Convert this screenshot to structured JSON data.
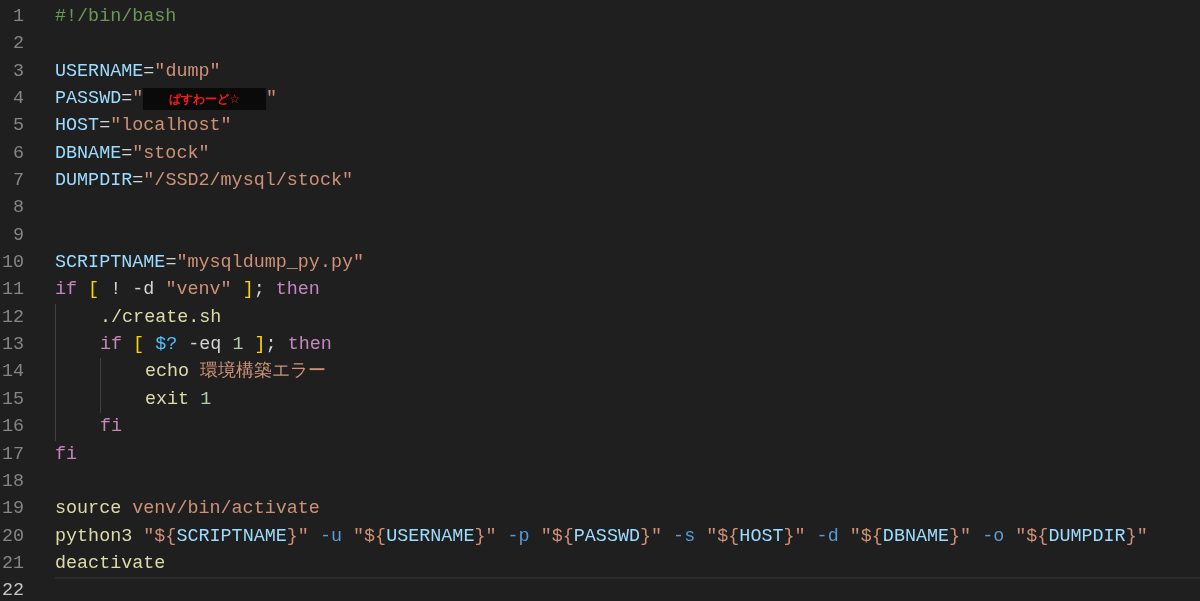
{
  "editor": {
    "lines": [
      {
        "number": "1",
        "current": false,
        "tokens": [
          {
            "text": "#!/bin/bash",
            "kind": "comment"
          }
        ]
      },
      {
        "number": "2",
        "current": false
      },
      {
        "number": "3",
        "current": false,
        "tokens": [
          {
            "text": "USERNAME",
            "kind": "var"
          },
          {
            "text": "=",
            "kind": "op"
          },
          {
            "text": "\"dump\"",
            "kind": "string"
          }
        ]
      },
      {
        "number": "4",
        "current": false,
        "tokens": [
          {
            "text": "PASSWD",
            "kind": "var"
          },
          {
            "text": "=",
            "kind": "op"
          },
          {
            "text": "\"",
            "kind": "string"
          },
          {
            "text": "ぱすわーど☆",
            "kind": "redaction"
          },
          {
            "text": "\"",
            "kind": "string"
          }
        ]
      },
      {
        "number": "5",
        "current": false,
        "tokens": [
          {
            "text": "HOST",
            "kind": "var"
          },
          {
            "text": "=",
            "kind": "op"
          },
          {
            "text": "\"localhost\"",
            "kind": "string"
          }
        ]
      },
      {
        "number": "6",
        "current": false,
        "tokens": [
          {
            "text": "DBNAME",
            "kind": "var"
          },
          {
            "text": "=",
            "kind": "op"
          },
          {
            "text": "\"stock\"",
            "kind": "string"
          }
        ]
      },
      {
        "number": "7",
        "current": false,
        "tokens": [
          {
            "text": "DUMPDIR",
            "kind": "var"
          },
          {
            "text": "=",
            "kind": "op"
          },
          {
            "text": "\"/SSD2/mysql/stock\"",
            "kind": "string"
          }
        ]
      },
      {
        "number": "8",
        "current": false
      },
      {
        "number": "9",
        "current": false
      },
      {
        "number": "10",
        "current": false,
        "tokens": [
          {
            "text": "SCRIPTNAME",
            "kind": "var"
          },
          {
            "text": "=",
            "kind": "op"
          },
          {
            "text": "\"mysqldump_py.py\"",
            "kind": "string"
          }
        ]
      },
      {
        "number": "11",
        "current": false,
        "tokens": [
          {
            "text": "if",
            "kind": "keyword"
          },
          {
            "text": " [",
            "kind": "bracket"
          },
          {
            "text": " ! -d ",
            "kind": "op"
          },
          {
            "text": "\"venv\"",
            "kind": "string"
          },
          {
            "text": " ]",
            "kind": "bracket"
          },
          {
            "text": "; ",
            "kind": "op"
          },
          {
            "text": "then",
            "kind": "keyword"
          }
        ],
        "children": [
          {
            "number": "12",
            "current": false,
            "tokens": [
              {
                "text": "./create.sh",
                "kind": "command"
              }
            ]
          },
          {
            "number": "13",
            "current": false,
            "tokens": [
              {
                "text": "if",
                "kind": "keyword"
              },
              {
                "text": " [",
                "kind": "bracket"
              },
              {
                "text": " $?",
                "kind": "special"
              },
              {
                "text": " -eq ",
                "kind": "op"
              },
              {
                "text": "1",
                "kind": "number"
              },
              {
                "text": " ]",
                "kind": "bracket"
              },
              {
                "text": "; ",
                "kind": "op"
              },
              {
                "text": "then",
                "kind": "keyword"
              }
            ],
            "children": [
              {
                "number": "14",
                "current": false,
                "tokens": [
                  {
                    "text": "echo",
                    "kind": "command"
                  },
                  {
                    "text": " 環境構築エラー",
                    "kind": "string"
                  }
                ]
              },
              {
                "number": "15",
                "current": false,
                "tokens": [
                  {
                    "text": "exit",
                    "kind": "command"
                  },
                  {
                    "text": " 1",
                    "kind": "number"
                  }
                ]
              }
            ]
          },
          {
            "number": "16",
            "current": false,
            "tokens": [
              {
                "text": "fi",
                "kind": "keyword"
              }
            ]
          }
        ]
      },
      {
        "number": "17",
        "current": false,
        "tokens": [
          {
            "text": "fi",
            "kind": "keyword"
          }
        ]
      },
      {
        "number": "18",
        "current": false
      },
      {
        "number": "19",
        "current": false,
        "tokens": [
          {
            "text": "source",
            "kind": "command"
          },
          {
            "text": " venv/bin/activate",
            "kind": "string"
          }
        ]
      },
      {
        "number": "20",
        "current": false,
        "tokens": [
          {
            "text": "python3",
            "kind": "command"
          },
          {
            "text": " \"${",
            "kind": "string"
          },
          {
            "text": "SCRIPTNAME",
            "kind": "var"
          },
          {
            "text": "}\"",
            "kind": "string"
          },
          {
            "text": " -u ",
            "kind": "flag"
          },
          {
            "text": "\"${",
            "kind": "string"
          },
          {
            "text": "USERNAME",
            "kind": "var"
          },
          {
            "text": "}\"",
            "kind": "string"
          },
          {
            "text": " -p ",
            "kind": "flag"
          },
          {
            "text": "\"${",
            "kind": "string"
          },
          {
            "text": "PASSWD",
            "kind": "var"
          },
          {
            "text": "}\"",
            "kind": "string"
          },
          {
            "text": " -s ",
            "kind": "flag"
          },
          {
            "text": "\"${",
            "kind": "string"
          },
          {
            "text": "HOST",
            "kind": "var"
          },
          {
            "text": "}\"",
            "kind": "string"
          },
          {
            "text": " -d ",
            "kind": "flag"
          },
          {
            "text": "\"${",
            "kind": "string"
          },
          {
            "text": "DBNAME",
            "kind": "var"
          },
          {
            "text": "}\"",
            "kind": "string"
          },
          {
            "text": " -o ",
            "kind": "flag"
          },
          {
            "text": "\"${",
            "kind": "string"
          },
          {
            "text": "DUMPDIR",
            "kind": "var"
          },
          {
            "text": "}\"",
            "kind": "string"
          }
        ]
      },
      {
        "number": "21",
        "current": false,
        "tokens": [
          {
            "text": "deactivate",
            "kind": "command"
          }
        ]
      },
      {
        "number": "22",
        "current": true
      }
    ]
  }
}
